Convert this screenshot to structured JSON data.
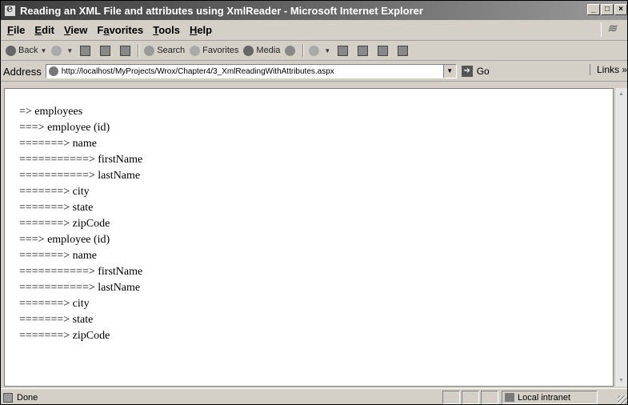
{
  "window": {
    "title": "Reading an XML File and attributes using XmlReader - Microsoft Internet Explorer"
  },
  "title_buttons": {
    "minimize": "_",
    "maximize": "□",
    "close": "×"
  },
  "menu": [
    "File",
    "Edit",
    "View",
    "Favorites",
    "Tools",
    "Help"
  ],
  "menu_underline": [
    "F",
    "E",
    "V",
    "a",
    "T",
    "H"
  ],
  "toolbar": {
    "back": "Back",
    "search": "Search",
    "favorites": "Favorites",
    "media": "Media"
  },
  "address": {
    "label": "Address",
    "url": "http://localhost/MyProjects/Wrox/Chapter4/3_XmlReadingWithAttributes.aspx",
    "go": "Go",
    "links": "Links »"
  },
  "content_lines": [
    "=> employees",
    "===> employee (id)",
    "=======> name",
    "===========> firstName",
    "===========> lastName",
    "=======> city",
    "=======> state",
    "=======> zipCode",
    "===> employee (id)",
    "=======> name",
    "===========> firstName",
    "===========> lastName",
    "=======> city",
    "=======> state",
    "=======> zipCode"
  ],
  "status": {
    "text": "Done",
    "zone": "Local intranet"
  }
}
